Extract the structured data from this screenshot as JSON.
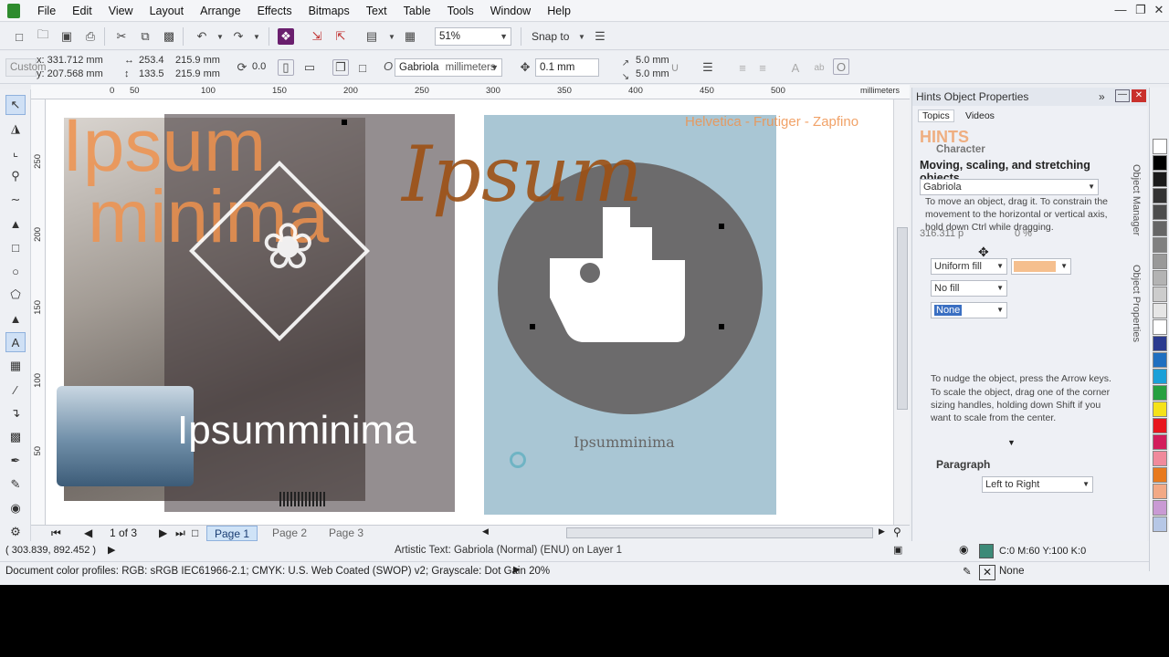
{
  "menubar": {
    "items": [
      "File",
      "Edit",
      "View",
      "Layout",
      "Arrange",
      "Effects",
      "Bitmaps",
      "Text",
      "Table",
      "Tools",
      "Window",
      "Help"
    ]
  },
  "toolbar": {
    "zoom": "51%",
    "snap_label": "Snap to"
  },
  "propbar": {
    "preset": "Custom",
    "x_value": "x: 331.712 mm",
    "y_value": "y: 207.568 mm",
    "width_value": "253.4",
    "width_value2": "215.9 mm",
    "height_value": "133.5",
    "height_value2": "215.9 mm",
    "angle_value": "0.0",
    "font_name": "Gabriola",
    "units": "millimeters",
    "nudge_value": "0.1 mm",
    "dup_x": "5.0 mm",
    "dup_y": "5.0 mm"
  },
  "ruler": {
    "unit": "millimeters",
    "h_labels": [
      "50",
      "0",
      "50",
      "100",
      "150",
      "200",
      "250",
      "300",
      "350",
      "400",
      "450",
      "500"
    ],
    "v_labels": [
      "250",
      "200",
      "150",
      "100",
      "50"
    ]
  },
  "canvas": {
    "headline_top": "Ipsum",
    "headline_bottom": "minima",
    "script_word": "Ipsum",
    "banner_word": "Ipsumminima",
    "font_note": "Helvetica - Frutiger - Zapfino",
    "poster_word": "Ipsumminima"
  },
  "pages": {
    "counter": "1 of 3",
    "tabs": [
      "Page 1",
      "Page 2",
      "Page 3"
    ]
  },
  "status": {
    "coords": "( 303.839, 892.452 )",
    "object_info": "Artistic Text: Gabriola (Normal) (ENU) on Layer 1",
    "color_profiles": "Document color profiles: RGB: sRGB IEC61966-2.1; CMYK: U.S. Web Coated (SWOP) v2; Grayscale: Dot Gain 20%",
    "fill_value": "C:0 M:60 Y:100 K:0",
    "outline_value": "None",
    "fill_color": "#3d8a78"
  },
  "docker": {
    "title": "Hints Object Properties",
    "tab_topics": "Topics",
    "tab_videos": "Videos",
    "hints_heading": "HINTS",
    "character_label": "Character",
    "hint_title": "Moving, scaling, and stretching objects",
    "hint_text_1": "To move an object, drag it. To constrain the movement to the horizontal or vertical axis, hold down Ctrl while dragging.",
    "font_value": "Gabriola",
    "font_size": "316.311 p",
    "kerning": "0 %",
    "fill_type": "Uniform fill",
    "bg_fill": "No fill",
    "outline": "None",
    "hint_text_2": "To nudge the object, press the Arrow keys.",
    "hint_text_3": "To scale the object, drag one of the corner sizing handles, holding down Shift if you want to scale from the center.",
    "paragraph_label": "Paragraph",
    "direction": "Left to Right",
    "side_tab_1": "Object Manager",
    "side_tab_2": "Object Properties",
    "fill_swatch": "#f5bf8e"
  },
  "palette": {
    "colors": [
      "#ffffff",
      "#000000",
      "#1a1a1a",
      "#333333",
      "#4d4d4d",
      "#666666",
      "#808080",
      "#999999",
      "#b3b3b3",
      "#cccccc",
      "#e6e6e6",
      "#ffffff",
      "#2a3a8f",
      "#1f6fc0",
      "#1aa0d8",
      "#26a040",
      "#f5e21a",
      "#e8161e",
      "#d31d5c",
      "#f08a9c",
      "#e87a1e",
      "#f2a986",
      "#c99ad4",
      "#b6c7e6"
    ]
  }
}
